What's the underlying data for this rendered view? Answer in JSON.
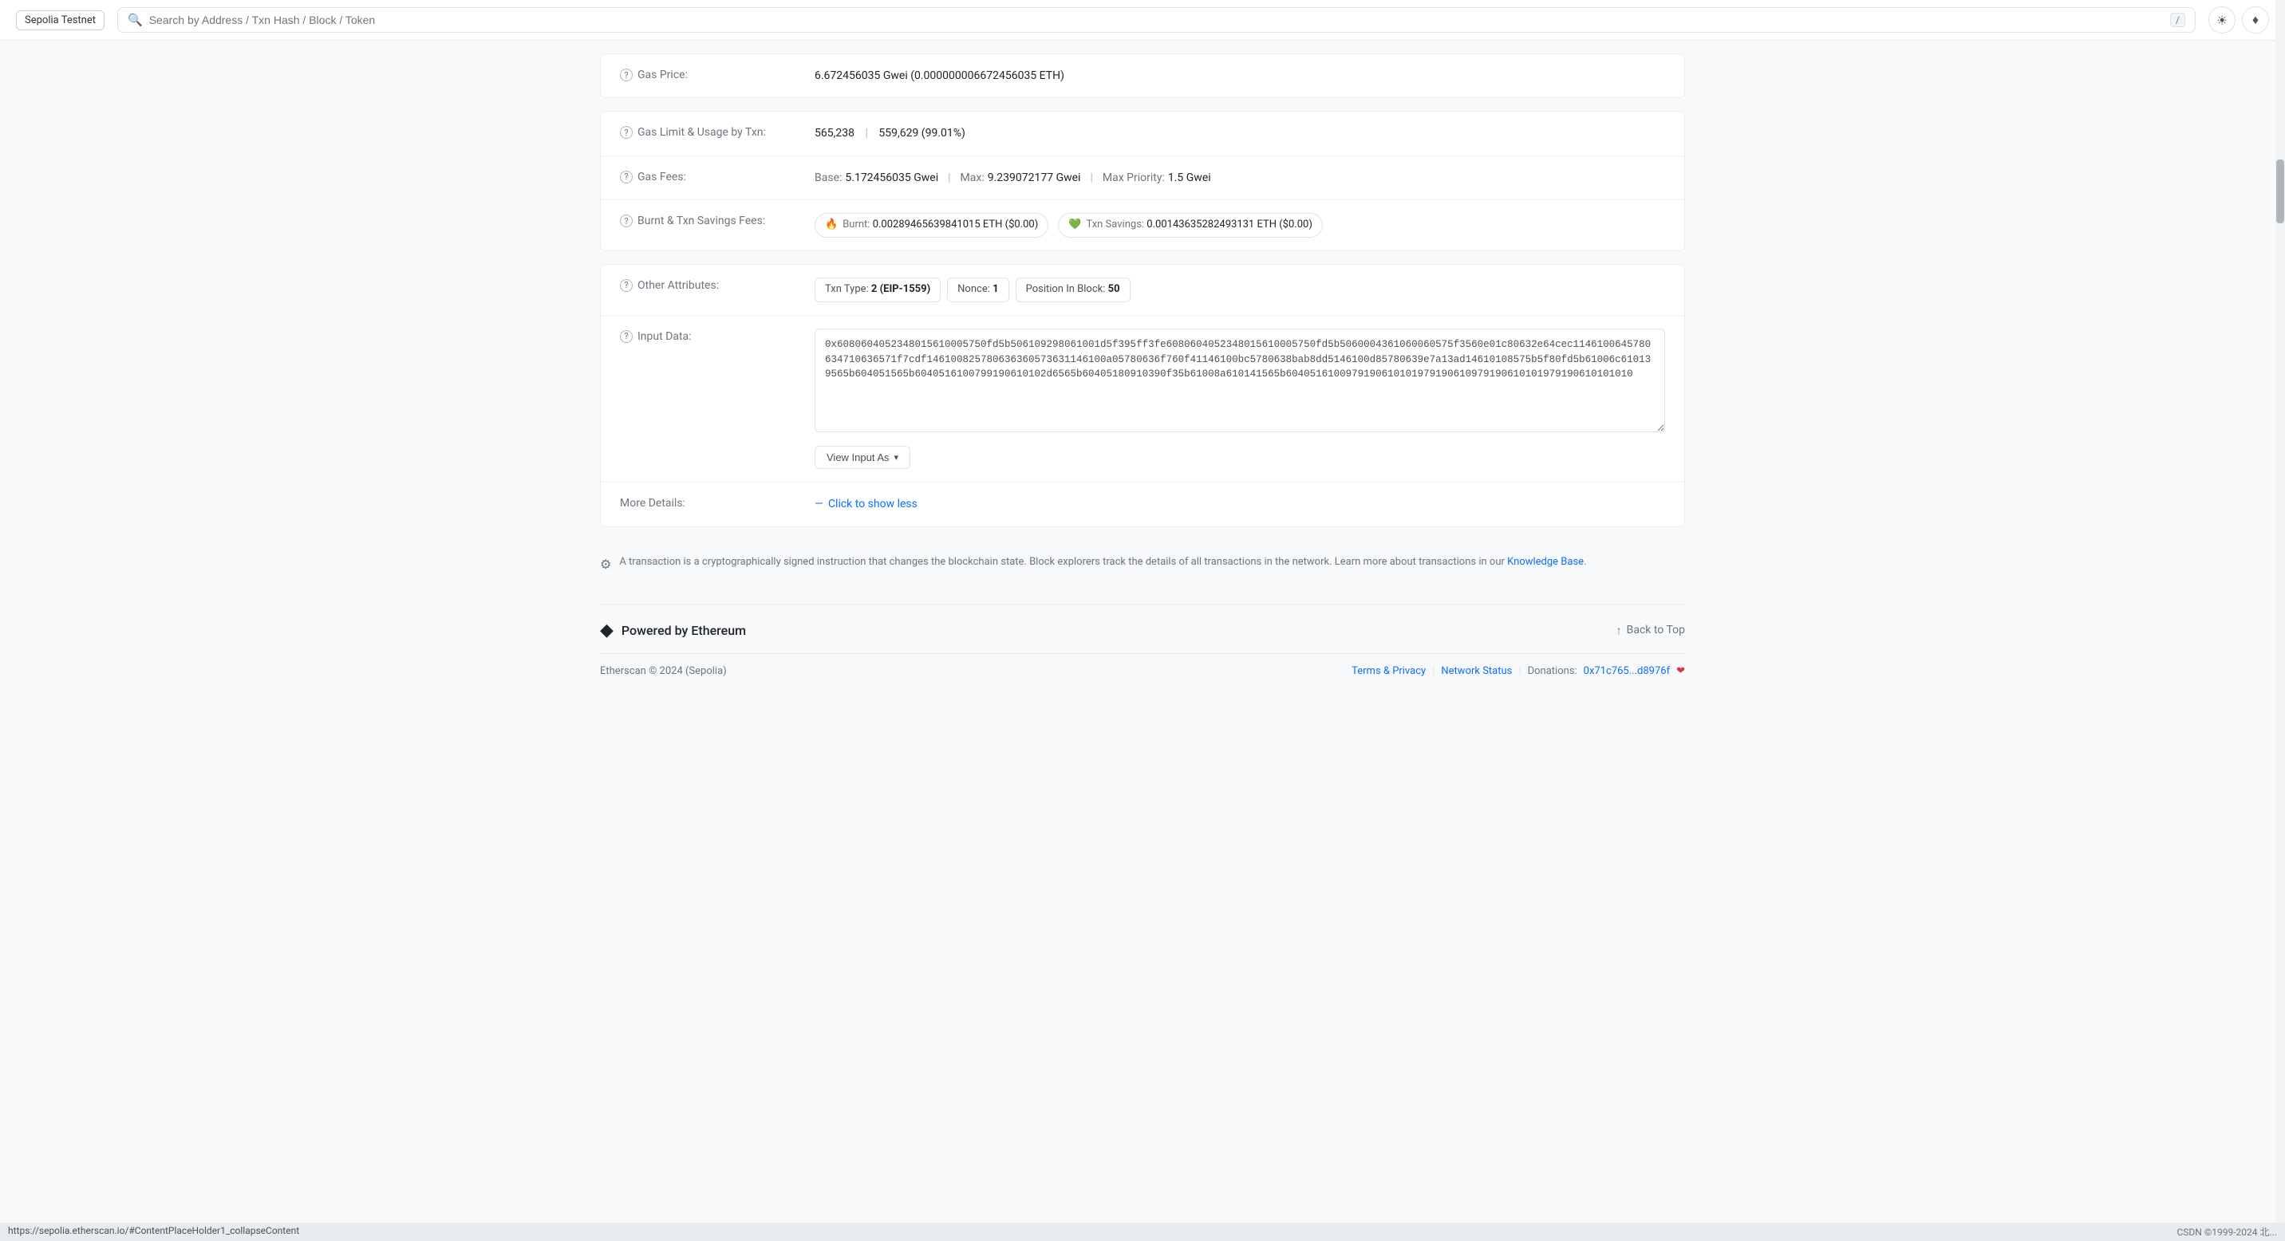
{
  "header": {
    "network_label": "Sepolia Testnet",
    "search_placeholder": "Search by Address / Txn Hash / Block / Token",
    "kbd_shortcut": "/",
    "sun_icon": "☀",
    "eth_icon": "♦"
  },
  "gas_price_row": {
    "label": "Gas Price:",
    "value": "6.672456035 Gwei (0.000000006672456035 ETH)"
  },
  "gas_limit_row": {
    "label": "Gas Limit & Usage by Txn:",
    "limit": "565,238",
    "separator": "|",
    "usage": "559,629 (99.01%)"
  },
  "gas_fees_row": {
    "label": "Gas Fees:",
    "base_label": "Base:",
    "base_value": "5.172456035 Gwei",
    "sep1": "|",
    "max_label": "Max:",
    "max_value": "9.239072177 Gwei",
    "sep2": "|",
    "max_priority_label": "Max Priority:",
    "max_priority_value": "1.5 Gwei"
  },
  "burnt_fees_row": {
    "label": "Burnt & Txn Savings Fees:",
    "burnt_label": "Burnt:",
    "burnt_value": "0.00289465639841015 ETH ($0.00)",
    "savings_label": "Txn Savings:",
    "savings_value": "0.00143635282493131 ETH ($0.00)"
  },
  "other_attrs_row": {
    "label": "Other Attributes:",
    "txn_type_label": "Txn Type:",
    "txn_type_value": "2 (EIP-1559)",
    "nonce_label": "Nonce:",
    "nonce_value": "1",
    "position_label": "Position In Block:",
    "position_value": "50"
  },
  "input_data_row": {
    "label": "Input Data:",
    "value": "0x6080604052348015610005750fd5b506109298061001d5f395ff3fe6080604052348015610005750fd5b5060004361060060575f3560e01c80632e64cec1146100645780634710636571f7cdf146100825780636360573631146100a05780636f760f41146100bc5780638bab8dd5146100d85780639e7a13ad14610108575b5f80fd5b61006c610139565b604051565b6040516100799190610102d6565b60405180910390f35b61008a610141565b6040516100979190610101979190610979190610101979190610101010",
    "view_input_label": "View Input As",
    "chevron": "▾"
  },
  "more_details_row": {
    "label": "More Details:",
    "link_text": "Click to show less",
    "dash": "—"
  },
  "info_text": "A transaction is a cryptographically signed instruction that changes the blockchain state. Block explorers track the details of all transactions in the network. Learn more about transactions in our",
  "knowledge_base_link": "Knowledge Base.",
  "powered_by": {
    "label": "Powered by Ethereum"
  },
  "back_to_top": {
    "label": "Back to Top",
    "arrow": "↑"
  },
  "footer": {
    "copyright": "Etherscan © 2024 (Sepolia)",
    "terms_label": "Terms & Privacy",
    "network_status_label": "Network Status",
    "donations_label": "Donations:",
    "donations_address": "0x71c765...d8976f"
  },
  "status_bar": {
    "url": "https://sepolia.etherscan.io/#ContentPlaceHolder1_collapseContent",
    "right_text": "CSDN ©1999-2024 北..."
  }
}
